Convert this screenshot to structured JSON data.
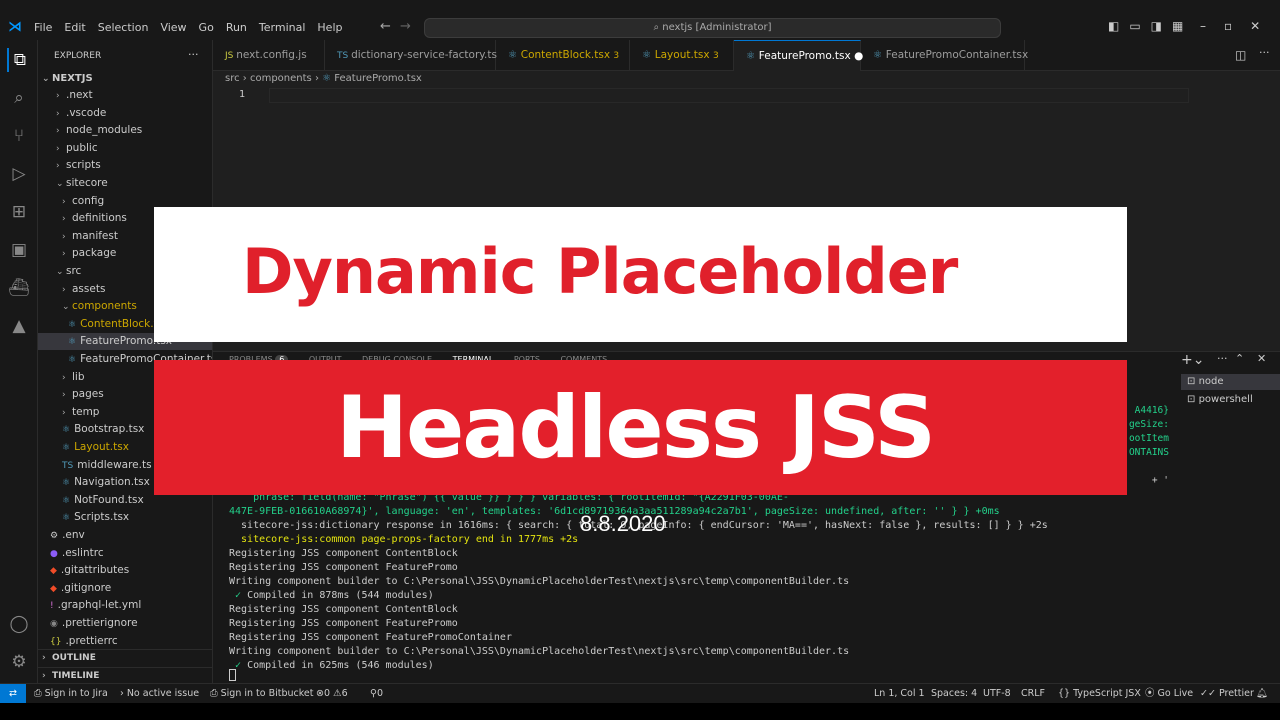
{
  "menu": [
    "File",
    "Edit",
    "Selection",
    "View",
    "Go",
    "Run",
    "Terminal",
    "Help"
  ],
  "command_center": "nextjs [Administrator]",
  "explorer": {
    "title": "EXPLORER",
    "root": "NEXTJS",
    "items": [
      ".next",
      ".vscode",
      "node_modules",
      "public",
      "scripts",
      "sitecore",
      "config",
      "definitions",
      "manifest",
      "package",
      "src",
      "assets",
      "components",
      "ContentBlock.tsx",
      "FeaturePromo.tsx",
      "FeaturePromoContainer.tsx",
      "lib",
      "pages",
      "temp",
      "Bootstrap.tsx",
      "Layout.tsx",
      "middleware.ts",
      "Navigation.tsx",
      "NotFound.tsx",
      "Scripts.tsx",
      ".env",
      ".eslintrc",
      ".gitattributes",
      ".gitignore",
      ".graphql-let.yml",
      ".prettierignore",
      ".prettierrc"
    ],
    "outline": "OUTLINE",
    "timeline": "TIMELINE"
  },
  "tabs": [
    {
      "label": "next.config.js",
      "badge": ""
    },
    {
      "label": "dictionary-service-factory.ts",
      "badge": ""
    },
    {
      "label": "ContentBlock.tsx",
      "badge": "3"
    },
    {
      "label": "Layout.tsx",
      "badge": "3"
    },
    {
      "label": "FeaturePromo.tsx",
      "badge": ""
    },
    {
      "label": "FeaturePromoContainer.tsx",
      "badge": ""
    }
  ],
  "breadcrumb": [
    "src",
    "components",
    "FeaturePromo.tsx"
  ],
  "editor": {
    "line": "1"
  },
  "panel": {
    "tabs": [
      "PROBLEMS",
      "OUTPUT",
      "DEBUG CONSOLE",
      "TERMINAL",
      "PORTS",
      "COMMENTS"
    ],
    "problems_count": "6",
    "terminals": [
      "node",
      "powershell"
    ],
    "right_fragments": [
      "A4416}",
      "geSize:",
      "ootItem",
      "ONTAINS",
      "+ '"
    ],
    "lines": [
      "    phrase: field(name: \"Phrase\") {{ value }} } } } variables: { rootItemId: \"{A2291F03-00AE-",
      "447E-9FEB-016610A68974}', language: 'en', templates: '6d1cd89719364a3aa511289a94c2a7b1', pageSize: undefined, after: '' } } +0ms",
      "  sitecore-jss:dictionary response in 1616ms: { search: { total: 0, pageInfo: { endCursor: 'MA==', hasNext: false }, results: [] } } +2s",
      "  sitecore-jss:common page-props-factory end in 1777ms +2s",
      "Registering JSS component ContentBlock",
      "Registering JSS component FeaturePromo",
      "Writing component builder to C:\\Personal\\JSS\\DynamicPlaceholderTest\\nextjs\\src\\temp\\componentBuilder.ts",
      " ✓ Compiled in 878ms (544 modules)",
      "Registering JSS component ContentBlock",
      "Registering JSS component FeaturePromo",
      "Registering JSS component FeaturePromoContainer",
      "Writing component builder to C:\\Personal\\JSS\\DynamicPlaceholderTest\\nextjs\\src\\temp\\componentBuilder.ts",
      " ✓ Compiled in 625ms (546 modules)"
    ]
  },
  "status": {
    "jira": "Sign in to Jira",
    "issue": "No active issue",
    "bitbucket": "Sign in to Bitbucket",
    "errors": "0",
    "warnings": "6",
    "ports": "0",
    "position": "Ln 1, Col 1",
    "spaces": "Spaces: 4",
    "encoding": "UTF-8",
    "eol": "CRLF",
    "language": "TypeScript JSX",
    "golive": "Go Live",
    "prettier": "Prettier"
  },
  "overlay": {
    "title": "Dynamic Placeholder",
    "subtitle": "Headless JSS",
    "date": "8.8.2020"
  },
  "colors": {
    "banner_red": "#e3202b",
    "accent": "#0078d4"
  }
}
